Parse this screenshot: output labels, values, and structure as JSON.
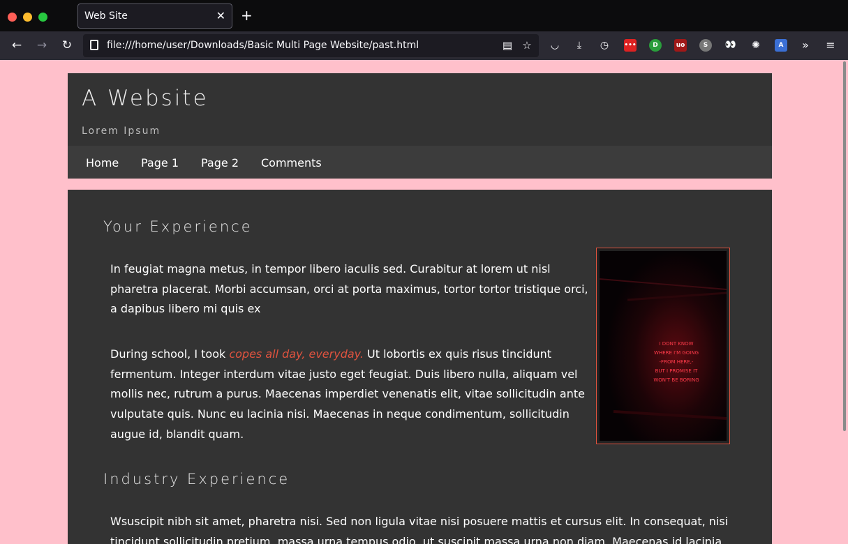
{
  "browser": {
    "tab_title": "Web Site",
    "url": "file:///home/user/Downloads/Basic Multi Page Website/past.html"
  },
  "site": {
    "title": "A Website",
    "subtitle": "Lorem Ipsum",
    "nav": [
      "Home",
      "Page 1",
      "Page 2",
      "Comments"
    ]
  },
  "content": {
    "section1_title": "Your Experience",
    "para1": "In feugiat magna metus, in tempor libero iaculis sed. Curabitur at lorem ut nisl pharetra placerat. Morbi accumsan, orci at porta maximus, tortor tortor tristique orci, a dapibus libero mi quis ex",
    "para2_prefix": "During school, I took ",
    "para2_link": "copes all day, everyday.",
    "para2_suffix": " Ut lobortis ex quis risus tincidunt fermentum. Integer interdum vitae justo eget feugiat. Duis libero nulla, aliquam vel mollis nec, rutrum a purus. Maecenas imperdiet venenatis elit, vitae sollicitudin ante vulputate quis. Nunc eu lacinia nisi. Maecenas in neque condimentum, sollicitudin augue id, blandit quam.",
    "section2_title": "Industry Experience",
    "para3": "Wsuscipit nibh sit amet, pharetra nisi. Sed non ligula vitae nisi posuere mattis et cursus elit. In consequat, nisi tincidunt sollicitudin pretium, massa urna tempus odio, ut suscipit massa urna non diam. Maecenas id lacinia",
    "image_sign": [
      "I DONT KNOW",
      "WHERE I'M GOING",
      "-FROM HERE,-",
      "BUT I PROMISE IT",
      "WON'T BE BORING"
    ]
  },
  "colors": {
    "page_background": "#ffc0cb",
    "panel": "#333333",
    "accent": "#e0533f"
  }
}
